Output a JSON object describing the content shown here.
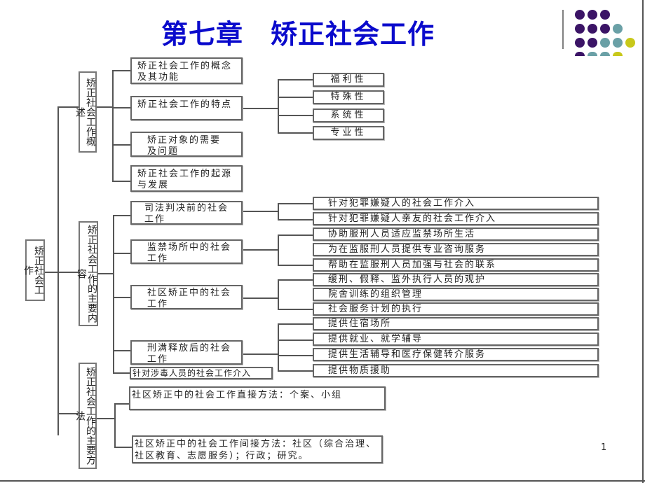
{
  "slide": {
    "title": "第七章　矫正社会工作",
    "page_number": "1",
    "decor_colors": {
      "purple": "#3b1466",
      "teal": "#6aa0a6",
      "yellow": "#c8c81a"
    }
  },
  "diagram": {
    "root": "矫正社会工作",
    "sections": [
      {
        "label": "矫正社会工作概述",
        "items": [
          {
            "label": "矫正社会工作的概念及其功能"
          },
          {
            "label": "矫正社会工作的特点",
            "children": [
              "福利性",
              "特殊性",
              "系统性",
              "专业性"
            ]
          },
          {
            "label": "矫正对象的需要及问题"
          },
          {
            "label": "矫正社会工作的起源与发展"
          }
        ]
      },
      {
        "label": "矫正社会工作的主要内容",
        "items": [
          {
            "label": "司法判决前的社会工作",
            "children": [
              "针对犯罪嫌疑人的社会工作介入",
              "针对犯罪嫌疑人亲友的社会工作介入"
            ]
          },
          {
            "label": "监禁场所中的社会工作",
            "children": [
              "协助服刑人员适应监禁场所生活",
              "为在监服刑人员提供专业咨询服务",
              "帮助在监服刑人员加强与社会的联系"
            ]
          },
          {
            "label": "社区矫正中的社会工作",
            "children": [
              "缓刑、假释、监外执行人员的观护",
              "院舍训练的组织管理",
              "社会服务计划的执行"
            ]
          },
          {
            "label": "刑满释放后的社会工作",
            "children": [
              "提供住宿场所",
              "提供就业、就学辅导",
              "提供生活辅导和医疗保健转介服务",
              "提供物质援助"
            ]
          },
          {
            "label": "针对涉毒人员的社会工作介入"
          }
        ]
      },
      {
        "label": "矫正社会工作的主要方法",
        "items": [
          {
            "label": "社区矫正中的社会工作直接方法：个案、小组"
          },
          {
            "label": "社区矫正中的社会工作间接方法：社区（综合治理、社区教育、志愿服务）；行政；研究。"
          }
        ]
      }
    ]
  }
}
